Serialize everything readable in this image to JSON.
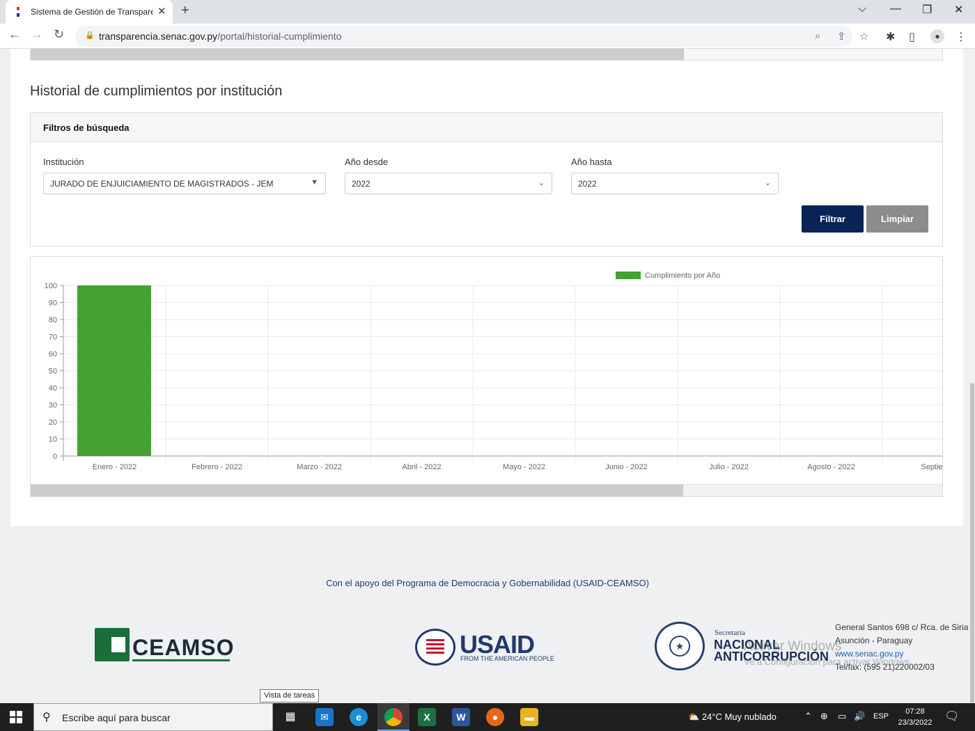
{
  "browser": {
    "tab_title": "Sistema de Gestión de Transpare",
    "url_host": "transparencia.senac.gov.py",
    "url_path": "/portal/historial-cumplimiento"
  },
  "page": {
    "heading": "Historial de cumplimientos por institución",
    "filters": {
      "panel_title": "Filtros de búsqueda",
      "institucion_label": "Institución",
      "institucion_value": "JURADO DE ENJUICIAMIENTO DE MAGISTRADOS - JEM",
      "anio_desde_label": "Año desde",
      "anio_desde_value": "2022",
      "anio_hasta_label": "Año hasta",
      "anio_hasta_value": "2022",
      "filter_button": "Filtrar",
      "clear_button": "Limpiar"
    }
  },
  "chart_data": {
    "type": "bar",
    "categories": [
      "Enero - 2022",
      "Febrero - 2022",
      "Marzo - 2022",
      "Abril - 2022",
      "Mayo - 2022",
      "Junio - 2022",
      "Julio - 2022",
      "Agosto - 2022",
      "Septiembre"
    ],
    "series": [
      {
        "name": "Cumplimiento por Año",
        "color": "#43a032",
        "values": [
          100,
          0,
          0,
          0,
          0,
          0,
          0,
          0,
          0
        ]
      }
    ],
    "ylim": [
      0,
      100
    ],
    "yticks": [
      0,
      10,
      20,
      30,
      40,
      50,
      60,
      70,
      80,
      90,
      100
    ],
    "grid": true,
    "legend": "top"
  },
  "footer": {
    "support_text": "Con el apoyo del Programa de Democracia y Gobernabilidad (USAID-CEAMSO)",
    "ceamso_logo": "CEAMSO",
    "usaid_logo": "USAID",
    "usaid_tagline": "FROM THE AMERICAN PEOPLE",
    "senac_sec": "Secretaría",
    "senac_name1": "NACIONAL",
    "senac_name2": "ANTICORRUPCIÓN",
    "address1": "General Santos 698 c/ Rca. de Siria",
    "address2": "Asunción - Paraguay",
    "website": "www.senac.gov.py",
    "phone": "Tel/fax: (595 21)220002/03"
  },
  "overlay": {
    "activate_windows": "Activar Windows",
    "activate_windows_sub": "Ve a Configuración para activar Windows."
  },
  "taskbar": {
    "tooltip": "Vista de tareas",
    "search_placeholder": "Escribe aquí para buscar",
    "weather": "24°C  Muy nublado",
    "language": "ESP",
    "time": "07:28",
    "date": "23/3/2022"
  }
}
